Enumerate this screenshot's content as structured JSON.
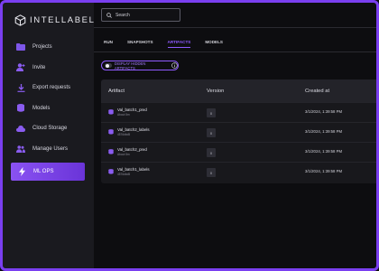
{
  "app": {
    "name": "INTELLABEL"
  },
  "sidebar": {
    "items": [
      {
        "label": "Projects",
        "icon": "folder-icon",
        "color": "#7d56e8"
      },
      {
        "label": "Invite",
        "icon": "user-plus-icon",
        "color": "#8a5cf0"
      },
      {
        "label": "Export requests",
        "icon": "download-icon",
        "color": "#8a5cf0"
      },
      {
        "label": "Models",
        "icon": "database-icon",
        "color": "#8a5cf0"
      },
      {
        "label": "Cloud Storage",
        "icon": "cloud-icon",
        "color": "#8a5cf0"
      },
      {
        "label": "Manage Users",
        "icon": "users-icon",
        "color": "#8a5cf0"
      },
      {
        "label": "ML OPS",
        "icon": "bolt-icon",
        "active": true
      }
    ]
  },
  "search": {
    "placeholder": "Search"
  },
  "tabs": [
    {
      "label": "RUN"
    },
    {
      "label": "SNAPSHOTS"
    },
    {
      "label": "ARTIFACTS",
      "active": true
    },
    {
      "label": "MODELS"
    }
  ],
  "toggle": {
    "label": "DISPLAY HIDDEN ARTIFACTS",
    "on": false
  },
  "table": {
    "columns": [
      "Artifact",
      "Version",
      "Created at"
    ],
    "rows": [
      {
        "name": "Val_batch1_pred",
        "sub": "About 5m",
        "version": "0",
        "created": "3/1/2024, 1:39:58 PM"
      },
      {
        "name": "Val_batch2_labels",
        "sub": "4576dbd5",
        "version": "0",
        "created": "3/1/2024, 1:39:58 PM"
      },
      {
        "name": "Val_batch2_pred",
        "sub": "About 5m",
        "version": "0",
        "created": "3/1/2024, 1:39:58 PM"
      },
      {
        "name": "Val_batch1_labels",
        "sub": "4576dbd5",
        "version": "0",
        "created": "3/1/2024, 1:39:58 PM"
      }
    ]
  },
  "colors": {
    "accent": "#8f5bff",
    "frame": "#7a3ff0",
    "sidebar_bg": "#1a1a1f",
    "main_bg": "#0d0d10"
  }
}
